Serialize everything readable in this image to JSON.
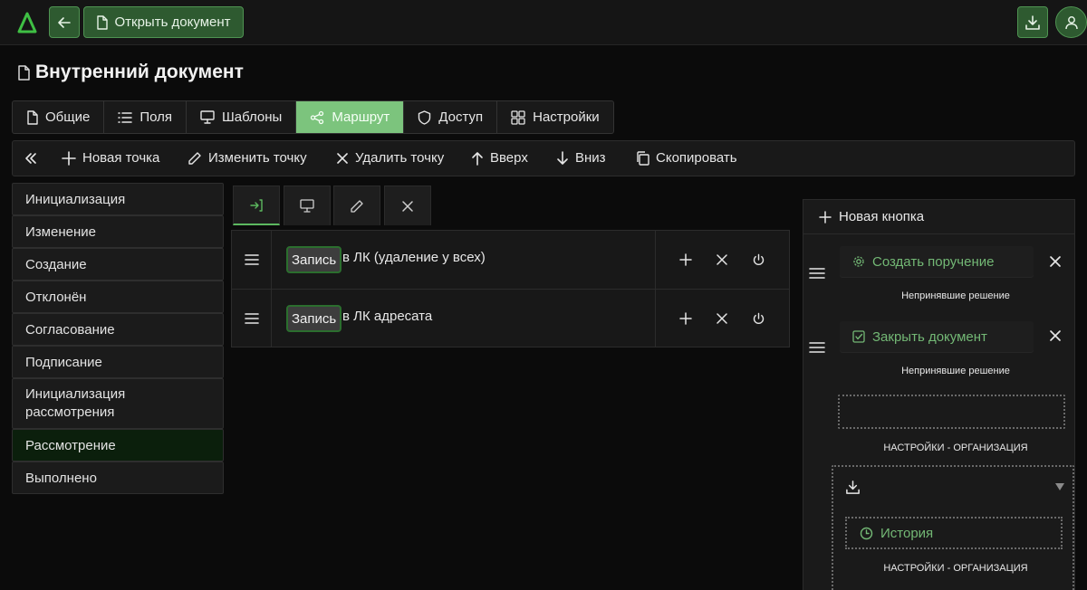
{
  "header": {
    "open_document_label": "Открыть документ",
    "logo_icon": "delta-logo-icon",
    "accent_color": "#4f9352"
  },
  "page": {
    "title": "Внутренний документ"
  },
  "tabs": [
    {
      "label": "Общие",
      "icon": "file-icon"
    },
    {
      "label": "Поля",
      "icon": "list-icon"
    },
    {
      "label": "Шаблоны",
      "icon": "monitor-icon"
    },
    {
      "label": "Маршрут",
      "icon": "share-icon",
      "active": true
    },
    {
      "label": "Доступ",
      "icon": "shield-icon"
    },
    {
      "label": "Настройки",
      "icon": "grid-icon"
    }
  ],
  "toolbar": {
    "new_point": "Новая точка",
    "edit_point": "Изменить точку",
    "delete_point": "Удалить точку",
    "up": "Вверх",
    "down": "Вниз",
    "copy": "Скопировать"
  },
  "stages": [
    {
      "label": "Инициализация"
    },
    {
      "label": "Изменение"
    },
    {
      "label": "Создание"
    },
    {
      "label": "Отклонён"
    },
    {
      "label": "Согласование"
    },
    {
      "label": "Подписание"
    },
    {
      "label": "Инициализация рассмотрения"
    },
    {
      "label": "Рассмотрение",
      "active": true
    },
    {
      "label": "Выполнено"
    }
  ],
  "actions_table": {
    "rows": [
      {
        "chip": "Запись",
        "text": "в ЛК (удаление у всех)"
      },
      {
        "chip": "Запись",
        "text": "в ЛК адресата"
      }
    ]
  },
  "right_panel": {
    "new_button": "Новая кнопка",
    "buttons": [
      {
        "label": "Создать поручение",
        "caption": "Непринявшие решение",
        "icon": "gear-icon"
      },
      {
        "label": "Закрыть документ",
        "caption": "Непринявшие решение",
        "icon": "check-square-icon"
      }
    ],
    "settings_caption_1": "НАСТРОЙКИ - ОРГАНИЗАЦИЯ",
    "history_label": "История",
    "settings_caption_2": "НАСТРОЙКИ - ОРГАНИЗАЦИЯ"
  }
}
